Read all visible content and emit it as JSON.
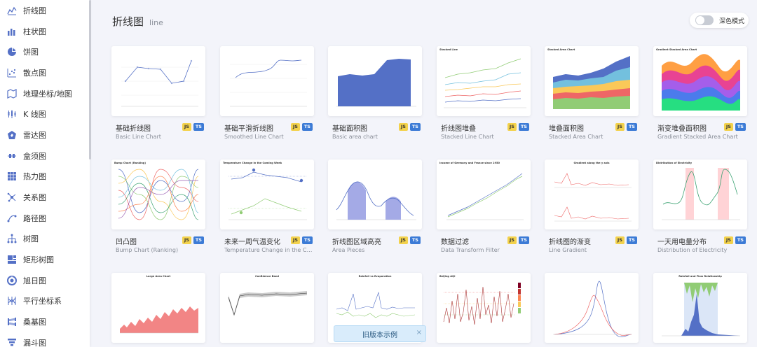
{
  "sidebar": {
    "items": [
      {
        "label": "折线图",
        "icon": "line-chart-icon"
      },
      {
        "label": "柱状图",
        "icon": "bar-chart-icon"
      },
      {
        "label": "饼图",
        "icon": "pie-chart-icon"
      },
      {
        "label": "散点图",
        "icon": "scatter-chart-icon"
      },
      {
        "label": "地理坐标/地图",
        "icon": "map-icon"
      },
      {
        "label": "K 线图",
        "icon": "candlestick-icon"
      },
      {
        "label": "雷达图",
        "icon": "radar-icon"
      },
      {
        "label": "盒须图",
        "icon": "boxplot-icon"
      },
      {
        "label": "热力图",
        "icon": "heatmap-icon"
      },
      {
        "label": "关系图",
        "icon": "graph-icon"
      },
      {
        "label": "路径图",
        "icon": "lines-icon"
      },
      {
        "label": "树图",
        "icon": "tree-icon"
      },
      {
        "label": "矩形树图",
        "icon": "treemap-icon"
      },
      {
        "label": "旭日图",
        "icon": "sunburst-icon"
      },
      {
        "label": "平行坐标系",
        "icon": "parallel-icon"
      },
      {
        "label": "桑基图",
        "icon": "sankey-icon"
      },
      {
        "label": "漏斗图",
        "icon": "funnel-icon"
      }
    ]
  },
  "header": {
    "title": "折线图",
    "subtitle": "line",
    "dark_mode_label": "深色模式"
  },
  "badges": {
    "js": "JS",
    "ts": "TS"
  },
  "cards": [
    {
      "title": "基础折线图",
      "subtitle": "Basic Line Chart",
      "thumb_title": ""
    },
    {
      "title": "基础平滑折线图",
      "subtitle": "Smoothed Line Chart",
      "thumb_title": ""
    },
    {
      "title": "基础面积图",
      "subtitle": "Basic area chart",
      "thumb_title": ""
    },
    {
      "title": "折线图堆叠",
      "subtitle": "Stacked Line Chart",
      "thumb_title": "Stacked Line"
    },
    {
      "title": "堆叠面积图",
      "subtitle": "Stacked Area Chart",
      "thumb_title": "Stacked Area Chart"
    },
    {
      "title": "渐变堆叠面积图",
      "subtitle": "Gradient Stacked Area Chart",
      "thumb_title": "Gradient Stacked Area Chart"
    },
    {
      "title": "凹凸图",
      "subtitle": "Bump Chart (Ranking)",
      "thumb_title": "Bump Chart (Ranking)"
    },
    {
      "title": "未来一周气温变化",
      "subtitle": "Temperature Change in the Coming Week",
      "thumb_title": "Temperature Change in the Coming Week"
    },
    {
      "title": "折线图区域高亮",
      "subtitle": "Area Pieces",
      "thumb_title": ""
    },
    {
      "title": "数据过滤",
      "subtitle": "Data Transform Filter",
      "thumb_title": "Income of Germany and France since 1950"
    },
    {
      "title": "折线图的渐变",
      "subtitle": "Line Gradient",
      "thumb_title": "Gradient along the y axis"
    },
    {
      "title": "一天用电量分布",
      "subtitle": "Distribution of Electricity",
      "thumb_title": "Distribution of Electricity"
    },
    {
      "title": "",
      "subtitle": "",
      "thumb_title": "Large Area Chart"
    },
    {
      "title": "",
      "subtitle": "",
      "thumb_title": "Confidence Band"
    },
    {
      "title": "",
      "subtitle": "",
      "thumb_title": "Rainfall vs Evaporation"
    },
    {
      "title": "",
      "subtitle": "",
      "thumb_title": "Beijing AQI"
    },
    {
      "title": "",
      "subtitle": "",
      "thumb_title": ""
    },
    {
      "title": "",
      "subtitle": "",
      "thumb_title": "Rainfall and Flow Relationship"
    }
  ],
  "toast": {
    "label": "旧版本示例",
    "close": "×"
  },
  "colors": {
    "accent": "#5470c6",
    "js_badge": "#f3d24c",
    "ts_badge": "#3c7bd6"
  }
}
